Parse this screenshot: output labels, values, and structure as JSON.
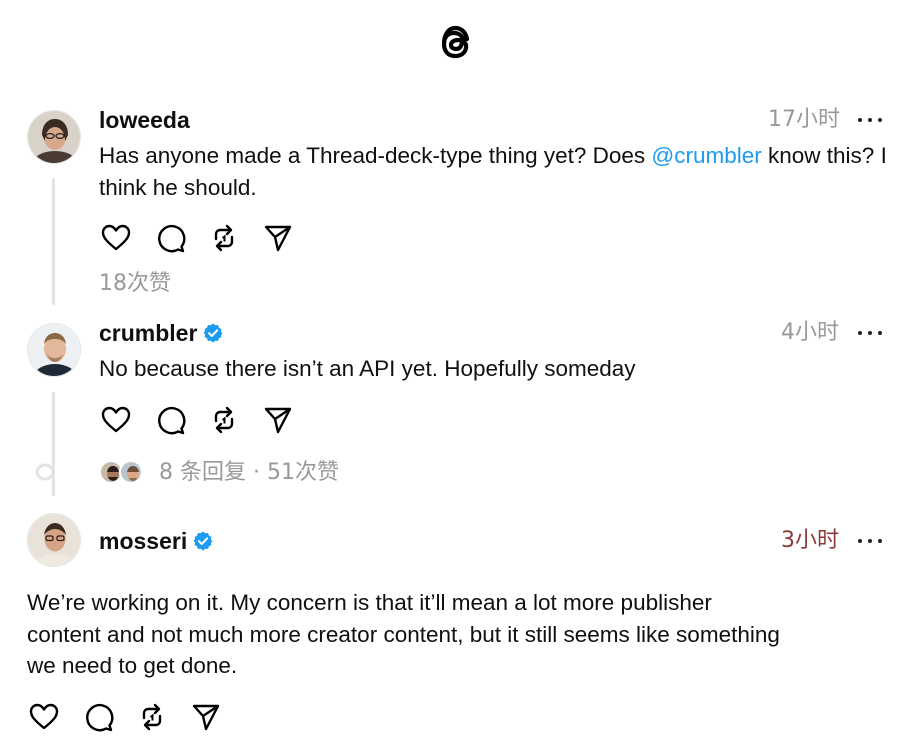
{
  "header": {
    "logo": "threads-logo-icon"
  },
  "posts": [
    {
      "username": "loweeda",
      "verified": false,
      "time": "17小时",
      "text_before": "Has anyone made a Thread-deck-type thing yet? Does ",
      "mention": "@crumbler",
      "text_after": " know this? I think he should.",
      "likes": "18次赞"
    },
    {
      "username": "crumbler",
      "verified": true,
      "time": "4小时",
      "text": "No because there isn’t an API yet. Hopefully someday",
      "replies_summary": "8 条回复 · 51次赞"
    },
    {
      "username": "mosseri",
      "verified": true,
      "time": "3小时",
      "text_line1": "We’re working on it. My concern is that it’ll mean a lot more publisher",
      "text_line2": "content and not much more creator content, but it still seems like something",
      "text_line3": "we need to get done."
    }
  ],
  "icons": [
    "heart-icon",
    "comment-icon",
    "repost-icon",
    "share-icon",
    "more-icon",
    "verified-icon"
  ],
  "colors": {
    "mention": "#1d9bf0",
    "verified": "#1d9bf0",
    "muted": "#999999"
  }
}
